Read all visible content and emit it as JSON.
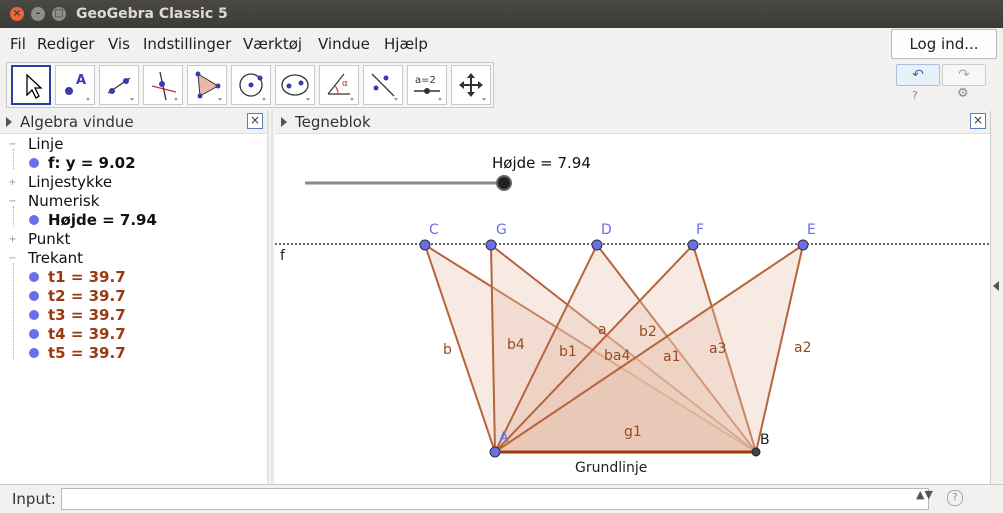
{
  "window": {
    "title": "GeoGebra Classic 5"
  },
  "menu": {
    "items": [
      "Fil",
      "Rediger",
      "Vis",
      "Indstillinger",
      "Værktøj",
      "Vindue",
      "Hjælp"
    ],
    "login": "Log ind..."
  },
  "toolbar": {
    "tools": [
      "move-tool-icon",
      "point-tool-icon",
      "line-tool-icon",
      "perpendicular-line-tool-icon",
      "polygon-tool-icon",
      "circle-tool-icon",
      "ellipse-tool-icon",
      "angle-tool-icon",
      "reflect-tool-icon",
      "slider-tool-icon",
      "move-graphics-view-tool-icon"
    ],
    "slider_tool_label": "a=2",
    "undo": "↶",
    "redo": "↷"
  },
  "algebra": {
    "title": "Algebra vindue",
    "groups": [
      {
        "label": "Linje",
        "items": [
          "f: y = 9.02"
        ]
      },
      {
        "label": "Linjestykke",
        "items": []
      },
      {
        "label": "Numerisk",
        "items": [
          "Højde = 7.94"
        ]
      },
      {
        "label": "Punkt",
        "items": []
      },
      {
        "label": "Trekant",
        "items": [
          "t1 = 39.7",
          "t2 = 39.7",
          "t3 = 39.7",
          "t4 = 39.7",
          "t5 = 39.7"
        ]
      }
    ]
  },
  "graphics": {
    "title": "Tegneblok",
    "slider_label": "Højde = 7.94",
    "slider_value": 7.94,
    "line_label": "f",
    "points": {
      "top": [
        "C",
        "G",
        "D",
        "F",
        "E"
      ],
      "base": [
        "A",
        "B"
      ]
    },
    "segment_labels": [
      "b",
      "b4",
      "b1",
      "a",
      "b2",
      "ba4",
      "a1",
      "a3",
      "a2",
      "g1"
    ],
    "base_label": "Grundlinje",
    "colors": {
      "triangle_fill": "#e8c4b0",
      "triangle_edge": "#b5643c",
      "point": "#6a6ee8",
      "label": "#9b4a1f",
      "point_label": "#6a6ee8"
    }
  },
  "input": {
    "label": "Input:",
    "placeholder": ""
  }
}
